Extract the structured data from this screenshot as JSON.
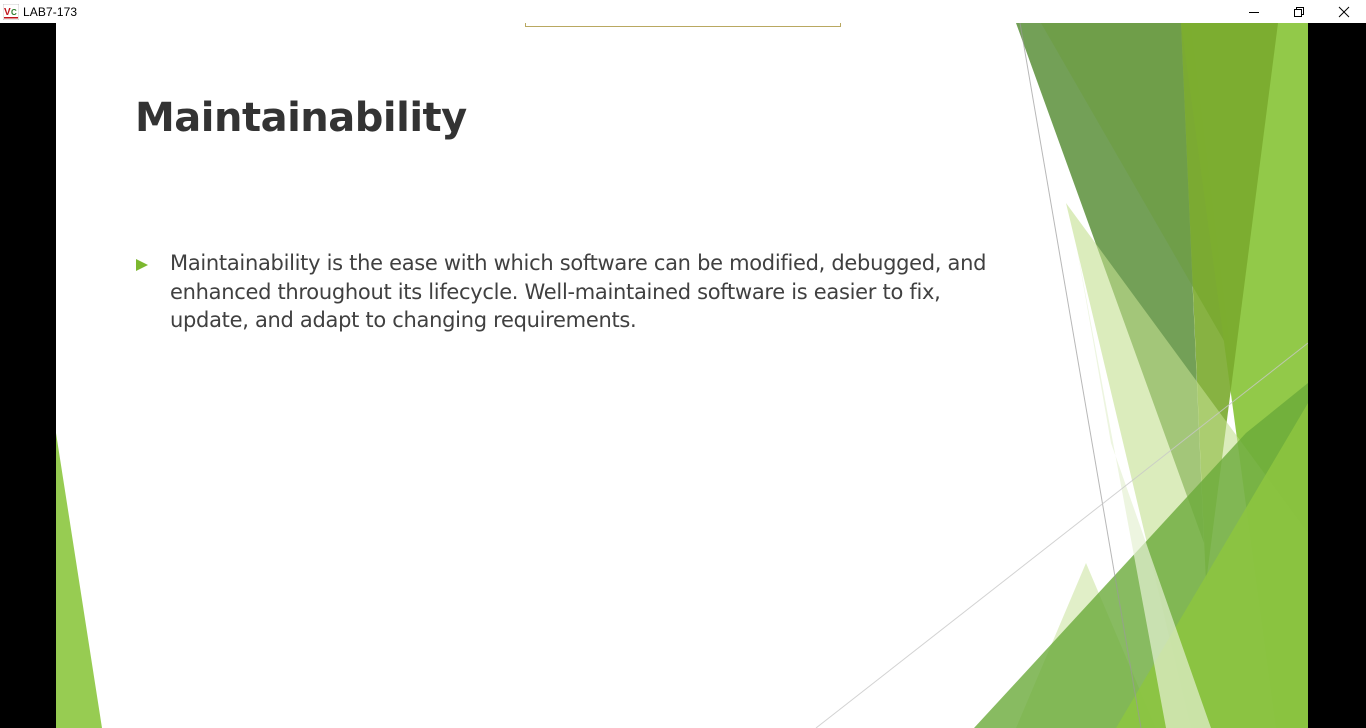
{
  "window": {
    "title": "LAB7-173",
    "app_icon": "vc-app-icon",
    "controls": [
      "minimize-icon",
      "restore-icon",
      "close-icon"
    ]
  },
  "slide": {
    "title": "Maintainability",
    "bullets": [
      {
        "text": "Maintainability is the ease with which software can be modified, debugged, and enhanced throughout its lifecycle. Well-maintained software is easier to fix, update, and adapt to changing requirements."
      }
    ]
  },
  "colors": {
    "bullet_accent": "#7cb82f",
    "green_dark": "#5b8f3a",
    "green_mid": "#8cc63f",
    "green_light": "#d4e8b0",
    "title_text": "#333333",
    "body_text": "#404040"
  }
}
